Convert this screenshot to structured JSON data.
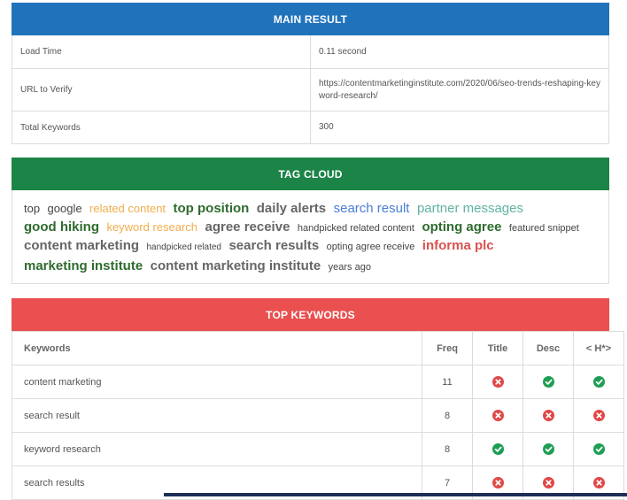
{
  "main_result": {
    "title": "MAIN RESULT",
    "rows": [
      {
        "key": "Load Time",
        "value": "0.11 second"
      },
      {
        "key": "URL to Verify",
        "value": "https://contentmarketinginstitute.com/2020/06/seo-trends-reshaping-keyword-research/"
      },
      {
        "key": "Total Keywords",
        "value": "300"
      }
    ]
  },
  "tag_cloud": {
    "title": "TAG CLOUD",
    "tags": [
      {
        "text": "top",
        "size": 13,
        "color": "#444444",
        "weight": "normal"
      },
      {
        "text": "google",
        "size": 13,
        "color": "#444444",
        "weight": "normal"
      },
      {
        "text": "related content",
        "size": 13,
        "color": "#f0ad4e",
        "weight": "normal"
      },
      {
        "text": "top position",
        "size": 15,
        "color": "#2e6b2e",
        "weight": "bold"
      },
      {
        "text": "daily alerts",
        "size": 15,
        "color": "#666666",
        "weight": "bold"
      },
      {
        "text": "search result",
        "size": 15,
        "color": "#4a7ed6",
        "weight": "normal"
      },
      {
        "text": "partner messages",
        "size": 15,
        "color": "#5fb3a0",
        "weight": "normal"
      },
      {
        "text": "good hiking",
        "size": 15,
        "color": "#2e6b2e",
        "weight": "bold"
      },
      {
        "text": "keyword research",
        "size": 13,
        "color": "#f0ad4e",
        "weight": "normal"
      },
      {
        "text": "agree receive",
        "size": 15,
        "color": "#666666",
        "weight": "bold"
      },
      {
        "text": "handpicked related content",
        "size": 11,
        "color": "#444444",
        "weight": "normal"
      },
      {
        "text": "opting agree",
        "size": 15,
        "color": "#2e6b2e",
        "weight": "bold"
      },
      {
        "text": "featured snippet",
        "size": 11,
        "color": "#444444",
        "weight": "normal"
      },
      {
        "text": "content marketing",
        "size": 15,
        "color": "#666666",
        "weight": "bold"
      },
      {
        "text": "handpicked related",
        "size": 10,
        "color": "#444444",
        "weight": "normal"
      },
      {
        "text": "search results",
        "size": 15,
        "color": "#666666",
        "weight": "bold"
      },
      {
        "text": "opting agree receive",
        "size": 11,
        "color": "#444444",
        "weight": "normal"
      },
      {
        "text": "informa plc",
        "size": 15,
        "color": "#d9534f",
        "weight": "bold"
      },
      {
        "text": "marketing institute",
        "size": 15,
        "color": "#2e6b2e",
        "weight": "bold"
      },
      {
        "text": "content marketing institute",
        "size": 15,
        "color": "#666666",
        "weight": "bold"
      },
      {
        "text": "years ago",
        "size": 11,
        "color": "#444444",
        "weight": "normal"
      }
    ]
  },
  "top_keywords": {
    "title": "TOP KEYWORDS",
    "headers": [
      "Keywords",
      "Freq",
      "Title",
      "Desc",
      "< H*>"
    ],
    "rows": [
      {
        "keyword": "content marketing",
        "freq": "11",
        "title": false,
        "desc": true,
        "h": true
      },
      {
        "keyword": "search result",
        "freq": "8",
        "title": false,
        "desc": false,
        "h": false
      },
      {
        "keyword": "keyword research",
        "freq": "8",
        "title": true,
        "desc": true,
        "h": true
      },
      {
        "keyword": "search results",
        "freq": "7",
        "title": false,
        "desc": false,
        "h": false
      }
    ]
  },
  "colors": {
    "main_header": "#2073bb",
    "tag_header": "#1c8447",
    "keywords_header": "#e9504f",
    "check": "#1e9e55",
    "cross": "#e04848"
  },
  "icons": {
    "yes": "check-circle-icon",
    "no": "x-circle-icon"
  }
}
